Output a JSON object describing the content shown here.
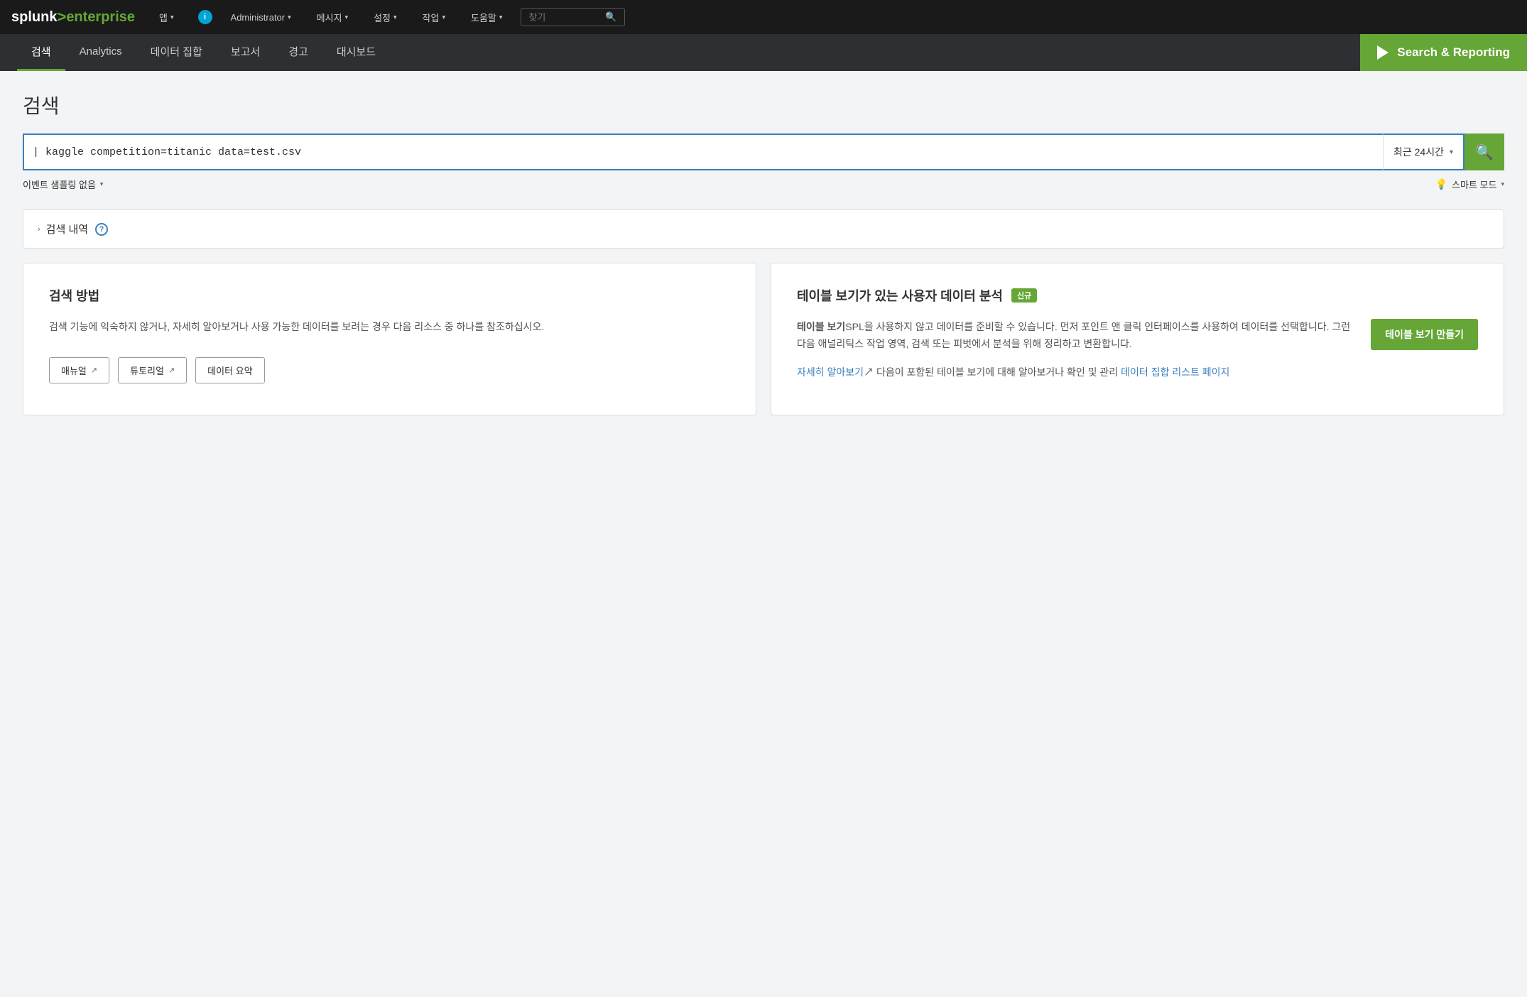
{
  "topNav": {
    "logo": {
      "splunk": "splunk",
      "arrow": ">",
      "enterprise": "enterprise"
    },
    "appMenu": {
      "label": "앱",
      "chevron": "▾"
    },
    "userMenu": {
      "infoIcon": "i",
      "label": "Administrator",
      "chevron": "▾"
    },
    "navItems": [
      {
        "label": "메시지",
        "chevron": "▾"
      },
      {
        "label": "설정",
        "chevron": "▾"
      },
      {
        "label": "작업",
        "chevron": "▾"
      },
      {
        "label": "도움말",
        "chevron": "▾"
      }
    ],
    "searchPlaceholder": "찾기"
  },
  "secNav": {
    "items": [
      {
        "label": "검색",
        "active": true
      },
      {
        "label": "Analytics"
      },
      {
        "label": "데이터 집합"
      },
      {
        "label": "보고서"
      },
      {
        "label": "경고"
      },
      {
        "label": "대시보드"
      }
    ],
    "appName": "Search & Reporting"
  },
  "pageTitle": "검색",
  "searchBar": {
    "value": "| kaggle competition=titanic data=test.csv",
    "timePicker": "최근 24시간",
    "timePickerChevron": "▾",
    "searchIconLabel": "🔍"
  },
  "optionsRow": {
    "sampling": {
      "label": "이벤트 샘플링 없음",
      "chevron": "▾"
    },
    "smartMode": {
      "bulb": "💡",
      "label": "스마트 모드",
      "chevron": "▾"
    }
  },
  "historyPanel": {
    "chevron": "›",
    "label": "검색 내역",
    "helpIcon": "?"
  },
  "cardLeft": {
    "title": "검색 방법",
    "body": "검색 기능에 익숙하지 않거나, 자세히 알아보거나 사용 가능한 데이터를 보려는 경우 다음 리소스 중 하나를 참조하십시오.",
    "buttons": [
      {
        "label": "매뉴얼",
        "external": "↗"
      },
      {
        "label": "튜토리얼",
        "external": "↗"
      },
      {
        "label": "데이터 요약"
      }
    ]
  },
  "cardRight": {
    "title": "테이블 보기가 있는 사용자 데이터 분석",
    "badge": "신규",
    "bodyParts": {
      "boldText": "테이블 보기",
      "text1": "SPL을 사용하지 않고 데이터를 준비할 수 있습니다. 먼저 포인트 앤 클릭 인터페이스를 사용하여 데이터를 선택합니다. 그런 다음 애널리틱스 작업 영역, 검색 또는 피벗에서 분석을 위해 정리하고 변환합니다.",
      "linkLabel1": "자세히 알아보기",
      "linkIcon1": "↗",
      "text2": "다음이 포함된 테이블 보기에 대해 알아보거나 확인 및 관리",
      "linkLabel2": "데이터 집합 리스트 페이지",
      "createBtn": "테이블 보기 만들기"
    }
  }
}
